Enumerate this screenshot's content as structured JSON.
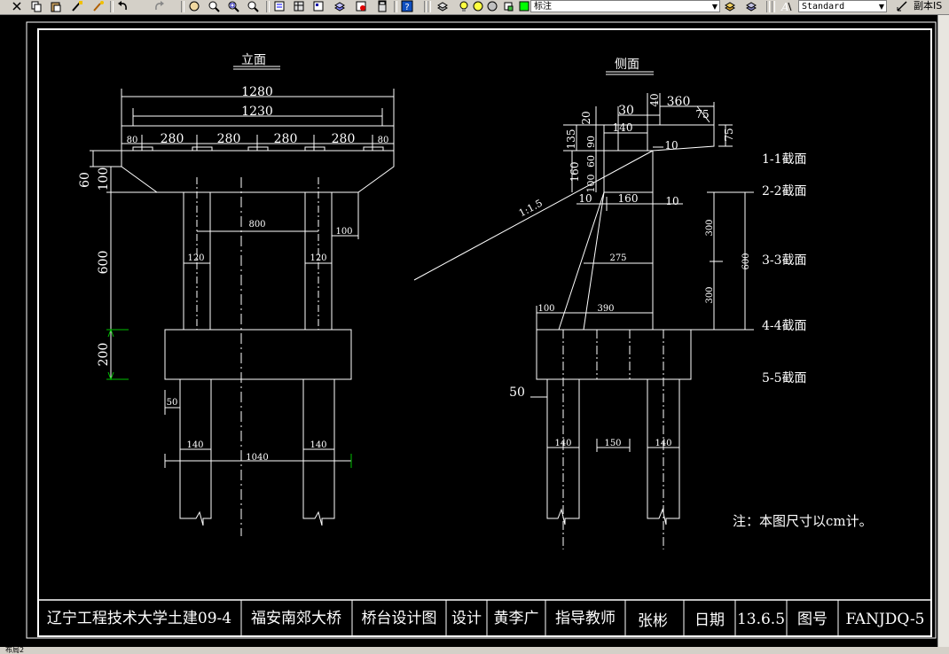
{
  "toolbar": {
    "layer_combo": "标注",
    "style_combo": "Standard",
    "right_label": "副本IS",
    "icons": [
      "cut-icon",
      "copy-icon",
      "paste-icon",
      "match-properties-icon",
      "brush-icon",
      "undo-icon",
      "redo-icon",
      "pan-icon",
      "zoom-realtime-icon",
      "zoom-window-icon",
      "zoom-previous-icon",
      "properties-icon",
      "design-center-icon",
      "tool-palette-icon",
      "sheet-set-icon",
      "markup-icon",
      "calculator-icon",
      "help-icon",
      "layer-manager-icon",
      "layer-state-icon",
      "text-style-icon"
    ]
  },
  "drawing": {
    "elevation_title": "立面",
    "side_title": "侧面",
    "elev_dims": {
      "total_width": "1280",
      "inner_width": "1230",
      "bearing_end": "80",
      "bearing_spacing": "280",
      "cap_end_height": "60",
      "cap_height": "100",
      "column_height": "600",
      "tie_beam_height": "200",
      "column_spacing": "800",
      "cap_overhang": "100",
      "column_width": "120",
      "beam_overhang": "50",
      "pile_diameter": "140",
      "pile_spacing": "1040"
    },
    "side_dims": {
      "top_40": "40",
      "top_360": "360",
      "top_30": "30",
      "top_75": "75",
      "right_75": "75",
      "d20": "20",
      "d140": "140",
      "d10": "10",
      "d135": "135",
      "d90": "90",
      "d60": "60",
      "d160v": "160",
      "d100v": "100",
      "slope": "1:1.5",
      "d10b": "10",
      "d160": "160",
      "d10c": "10",
      "d300a": "300",
      "d600": "600",
      "d300b": "300",
      "d275": "275",
      "d100": "100",
      "d390": "390",
      "d50": "50",
      "pile_140a": "140",
      "pile_150": "150",
      "pile_140b": "140"
    },
    "sections": [
      "1-1截面",
      "2-2截面",
      "3-3截面",
      "4-4截面",
      "5-5截面"
    ],
    "note": "注：本图尺寸以cm计。"
  },
  "title_block": {
    "school": "辽宁工程技术大学土建09-4",
    "project": "福安南郊大桥",
    "drawing_name": "桥台设计图",
    "design_label": "设计",
    "designer": "黄李广",
    "advisor_label": "指导教师",
    "advisor": "张彬",
    "date_label": "日期",
    "date": "13.6.5",
    "number_label": "图号",
    "number": "FANJDQ-5"
  },
  "status": {
    "layout_tab": "布局2"
  }
}
